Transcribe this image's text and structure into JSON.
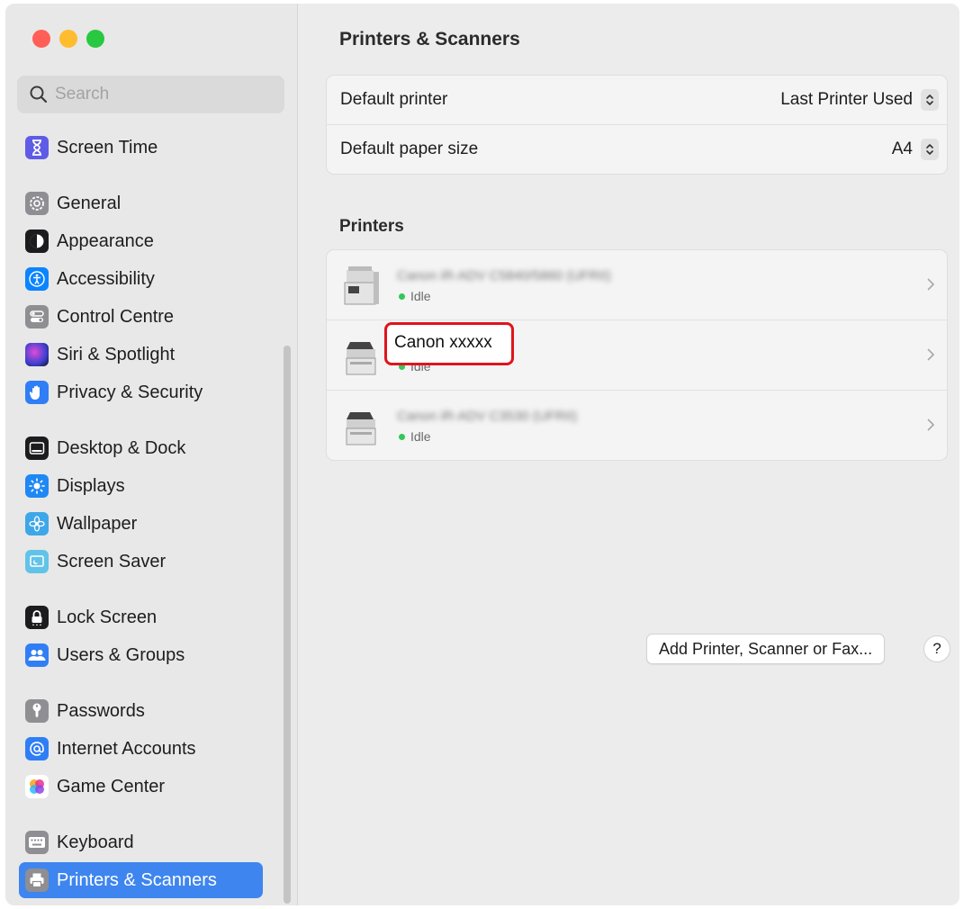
{
  "window": {
    "title": "Printers & Scanners"
  },
  "search": {
    "placeholder": "Search"
  },
  "sidebar": {
    "items": [
      {
        "label": "Screen Time",
        "icon": "hourglass-icon",
        "color": "#5e5ce6"
      },
      {
        "label": "General",
        "icon": "gear-icon",
        "color": "#8e8e93"
      },
      {
        "label": "Appearance",
        "icon": "appearance-icon",
        "color": "#1c1c1e"
      },
      {
        "label": "Accessibility",
        "icon": "accessibility-icon",
        "color": "#0a84ff"
      },
      {
        "label": "Control Centre",
        "icon": "control-centre-icon",
        "color": "#8e8e93"
      },
      {
        "label": "Siri & Spotlight",
        "icon": "siri-icon",
        "color": "#5e3bb7"
      },
      {
        "label": "Privacy & Security",
        "icon": "hand-icon",
        "color": "#2f7ef5"
      },
      {
        "label": "Desktop & Dock",
        "icon": "dock-icon",
        "color": "#1c1c1e"
      },
      {
        "label": "Displays",
        "icon": "sun-icon",
        "color": "#1e88f5"
      },
      {
        "label": "Wallpaper",
        "icon": "flower-icon",
        "color": "#3ea7e8"
      },
      {
        "label": "Screen Saver",
        "icon": "screen-saver-icon",
        "color": "#62c3e8"
      },
      {
        "label": "Lock Screen",
        "icon": "lock-icon",
        "color": "#1c1c1e"
      },
      {
        "label": "Users & Groups",
        "icon": "users-icon",
        "color": "#2f7ef5"
      },
      {
        "label": "Passwords",
        "icon": "key-icon",
        "color": "#8e8e93"
      },
      {
        "label": "Internet Accounts",
        "icon": "at-icon",
        "color": "#2f7ef5"
      },
      {
        "label": "Game Center",
        "icon": "game-center-icon",
        "color": "#ffffff"
      },
      {
        "label": "Keyboard",
        "icon": "keyboard-icon",
        "color": "#8e8e93"
      },
      {
        "label": "Printers & Scanners",
        "icon": "printer-icon",
        "color": "#8e8e93"
      }
    ],
    "selected": "Printers & Scanners"
  },
  "settings": {
    "default_printer": {
      "label": "Default printer",
      "value": "Last Printer Used"
    },
    "default_paper": {
      "label": "Default paper size",
      "value": "A4"
    }
  },
  "printers": {
    "section_title": "Printers",
    "list": [
      {
        "name": "Canon iR-ADV C5840/5860 (UFRII)",
        "status": "Idle",
        "obscured": true
      },
      {
        "name": "Canon xxxxx",
        "status": "Idle",
        "obscured": false
      },
      {
        "name": "Canon iR-ADV C3530 (UFRII)",
        "status": "Idle",
        "obscured": true
      }
    ]
  },
  "buttons": {
    "add": "Add Printer, Scanner or Fax...",
    "help": "?"
  },
  "colors": {
    "accent": "#3e85ef",
    "highlight": "#e0141b",
    "status_idle": "#34c759"
  }
}
